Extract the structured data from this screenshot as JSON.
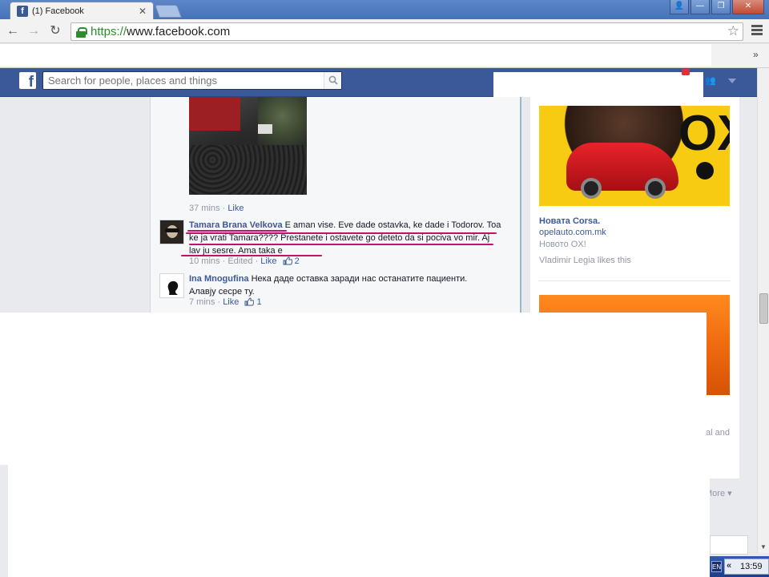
{
  "browser": {
    "tab_title": "(1) Facebook",
    "tab_close": "✕",
    "url_protocol": "https://",
    "url_host": "www.facebook.com",
    "bookmarks_more": "»",
    "window_buttons": {
      "user": "👤",
      "minimize": "—",
      "restore": "❐",
      "close": "✕"
    }
  },
  "fb_header": {
    "logo": "f",
    "search_placeholder": "Search for people, places and things"
  },
  "feed": {
    "photo_meta": {
      "time": "37 mins",
      "sep": " · ",
      "like": "Like"
    },
    "comments": [
      {
        "author": "Tamara Brana Velkova",
        "text": "E aman vise. Eve dade ostavka, ke dade i Todorov. Toa ke ja vrati Tamara???? Prestanete i ostavete go deteto da si pociva vo mir. Aj lav ju sesre. Ama taka e",
        "time": "10 mins",
        "edited": "Edited",
        "like": "Like",
        "likes": "2"
      },
      {
        "author": "Ina Mnogufina",
        "text": "Нека даде оставка заради нас останатите пациенти. Алавју сесре ту.",
        "time": "7 mins",
        "like": "Like",
        "likes": "1"
      }
    ]
  },
  "ads": {
    "ad1": {
      "image_text": "OX!",
      "title": "Новата Corsa.",
      "domain": "opelauto.com.mk",
      "description": "Новото OX!",
      "social": "Vladimir Legia likes this"
    },
    "ad2_fragment": "al and",
    "more": "More ▾"
  },
  "taskbar": {
    "language": "EN",
    "tray_arrow": "«",
    "clock": "13:59"
  },
  "colors": {
    "fb_blue": "#3b5998",
    "link_blue": "#3b5998",
    "meta_gray": "#9197a3",
    "annotation": "#c0136b",
    "ad_yellow": "#f7cb12"
  }
}
